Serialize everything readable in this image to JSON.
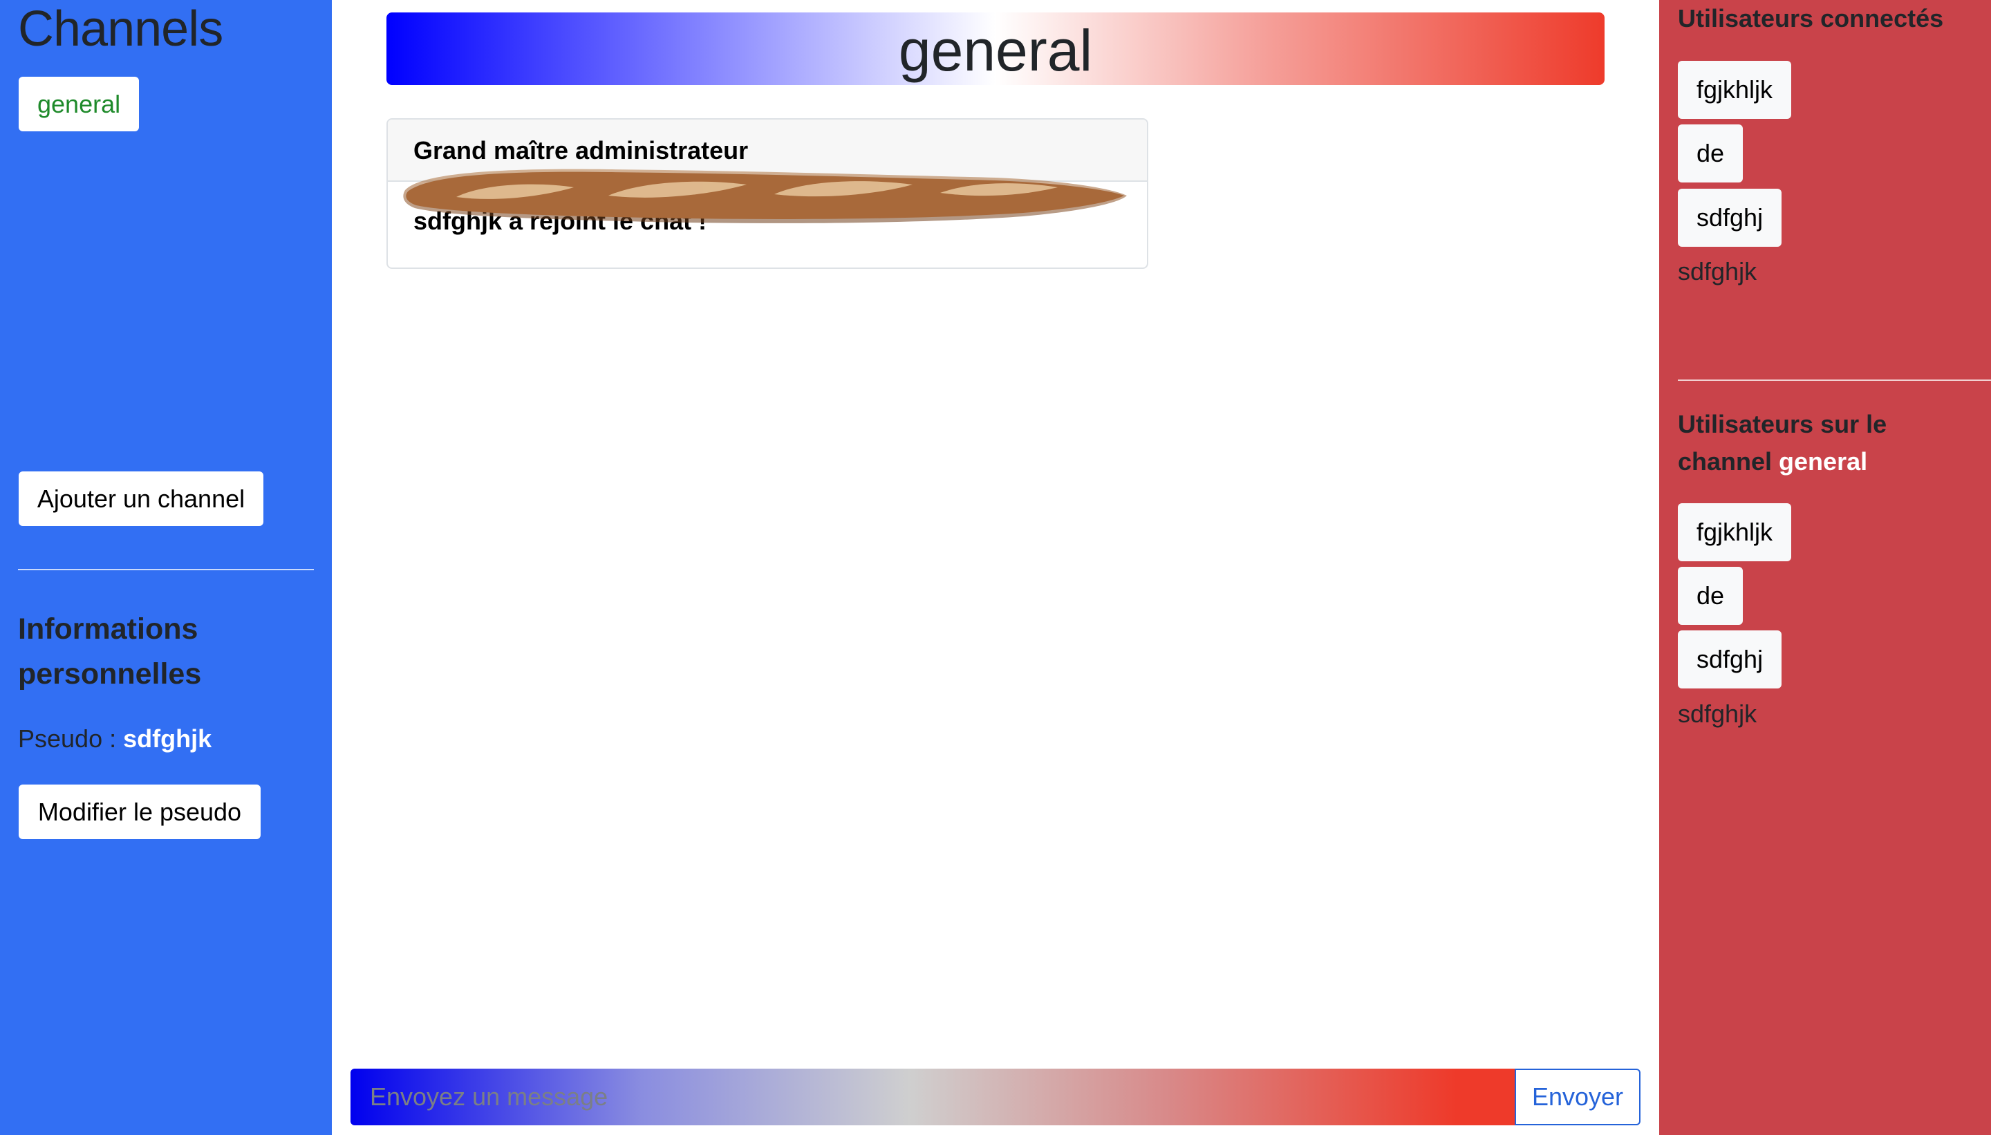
{
  "sidebar": {
    "title": "Channels",
    "channels": [
      {
        "label": "general",
        "color": "#1e8a2a"
      }
    ],
    "add_channel_label": "Ajouter un channel",
    "info_title": "Informations personnelles",
    "pseudo_label": "Pseudo : ",
    "pseudo_value": "sdfghjk",
    "modify_pseudo_label": "Modifier le pseudo",
    "background_color": "#326ff3"
  },
  "channel": {
    "name": "general"
  },
  "messages": [
    {
      "author": "Grand maître administrateur",
      "text": "sdfghjk a rejoint le chat !",
      "decoration": "baguette-image"
    }
  ],
  "composer": {
    "placeholder": "Envoyez un message",
    "value": "",
    "send_label": "Envoyer"
  },
  "right_panel": {
    "connected_title": "Utilisateurs connectés",
    "connected_users": [
      "fgjkhljk",
      "de",
      "sdfghj"
    ],
    "connected_self": "sdfghjk",
    "channel_users_title_prefix": "Utilisateurs sur le channel ",
    "channel_users_title_channel": "general",
    "channel_users": [
      "fgjkhljk",
      "de",
      "sdfghj"
    ],
    "channel_self": "sdfghjk",
    "background_color": "#c9434a"
  }
}
